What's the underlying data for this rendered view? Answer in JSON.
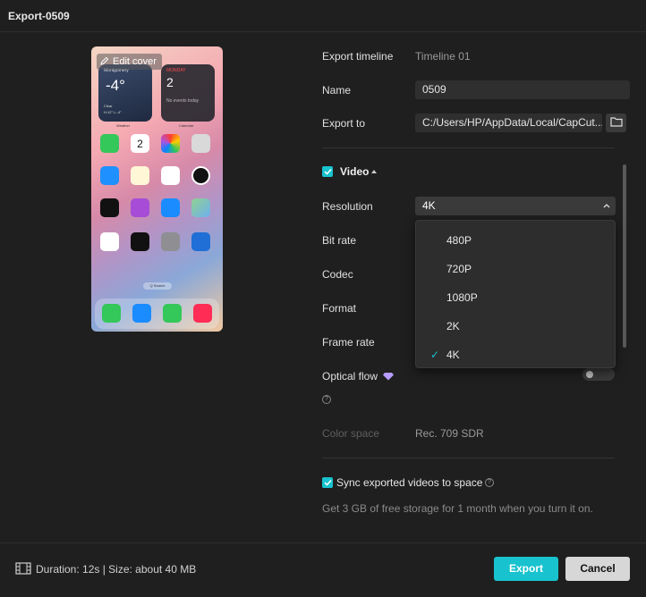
{
  "window": {
    "title": "Export-0509"
  },
  "cover": {
    "edit_label": "Edit cover",
    "weather": {
      "location": "Montgomery",
      "temp": "-4°",
      "condition": "Clear",
      "range": "H:12° L:-4°",
      "label": "Weather"
    },
    "calendar": {
      "day": "MONDAY",
      "date": "2",
      "events": "No events today",
      "label": "Calendar"
    },
    "search_label": "Q Search"
  },
  "settings": {
    "export_timeline_label": "Export timeline",
    "export_timeline_value": "Timeline 01",
    "name_label": "Name",
    "name_value": "0509",
    "export_to_label": "Export to",
    "export_to_value": "C:/Users/HP/AppData/Local/CapCut..."
  },
  "video": {
    "title": "Video",
    "resolution_label": "Resolution",
    "resolution_value": "4K",
    "bitrate_label": "Bit rate",
    "codec_label": "Codec",
    "format_label": "Format",
    "framerate_label": "Frame rate",
    "optical_flow_label": "Optical flow",
    "color_space_label": "Color space",
    "color_space_value": "Rec. 709 SDR",
    "resolution_options": [
      "480P",
      "720P",
      "1080P",
      "2K",
      "4K"
    ],
    "selected_option": "4K"
  },
  "sync": {
    "label": "Sync exported videos to space",
    "note": "Get 3 GB of free storage for 1 month when you turn it on."
  },
  "footer": {
    "info": "Duration: 12s | Size: about 40 MB",
    "export_label": "Export",
    "cancel_label": "Cancel"
  },
  "colors": {
    "accent": "#18c3cf",
    "background": "#1f1f1f",
    "field": "#2f2f2f"
  }
}
